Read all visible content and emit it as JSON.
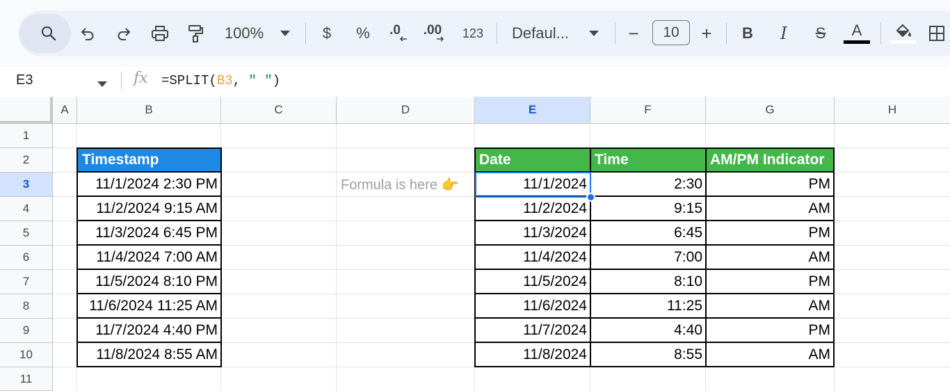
{
  "toolbar": {
    "zoom": "100%",
    "currency": "$",
    "percent": "%",
    "decrease_decimal": ".0",
    "increase_decimal": ".00",
    "number_format": "123",
    "font": "Defaul...",
    "font_size_minus": "−",
    "font_size": "10",
    "font_size_plus": "+",
    "bold": "B",
    "italic": "I",
    "strikethrough": "S",
    "text_color_glyph": "A",
    "text_color": "#000000",
    "fill_color": "#ffffff",
    "icons": [
      "search-icon",
      "undo-icon",
      "redo-icon",
      "print-icon",
      "paint-format-icon",
      "chevron-down-icon",
      "fill-color-icon",
      "borders-icon"
    ]
  },
  "formula_bar": {
    "name_box": "E3",
    "fx": "fx",
    "formula_prefix": "=SPLIT(",
    "formula_ref": "B3",
    "formula_mid": ", ",
    "formula_str": "\" \"",
    "formula_suffix": ")"
  },
  "columns": [
    "A",
    "B",
    "C",
    "D",
    "E",
    "F",
    "G",
    "H"
  ],
  "selected_column": "E",
  "rows": [
    "1",
    "2",
    "3",
    "4",
    "5",
    "6",
    "7",
    "8",
    "9",
    "10",
    "11"
  ],
  "selected_row": "3",
  "timestamp_table": {
    "header": "Timestamp",
    "header_color": "#1e88e5",
    "values": [
      "11/1/2024 2:30 PM",
      "11/2/2024 9:15 AM",
      "11/3/2024 6:45 PM",
      "11/4/2024 7:00 AM",
      "11/5/2024 8:10 PM",
      "11/6/2024 11:25 AM",
      "11/7/2024 4:40 PM",
      "11/8/2024 8:55 AM"
    ]
  },
  "note": "Formula is here 👉",
  "split_table": {
    "header_color": "#43b74a",
    "headers": [
      "Date",
      "Time",
      "AM/PM Indicator"
    ],
    "rows": [
      [
        "11/1/2024",
        "2:30",
        "PM"
      ],
      [
        "11/2/2024",
        "9:15",
        "AM"
      ],
      [
        "11/3/2024",
        "6:45",
        "PM"
      ],
      [
        "11/4/2024",
        "7:00",
        "AM"
      ],
      [
        "11/5/2024",
        "8:10",
        "PM"
      ],
      [
        "11/6/2024",
        "11:25",
        "AM"
      ],
      [
        "11/7/2024",
        "4:40",
        "PM"
      ],
      [
        "11/8/2024",
        "8:55",
        "AM"
      ]
    ]
  },
  "selection_color": "#1a73e8"
}
